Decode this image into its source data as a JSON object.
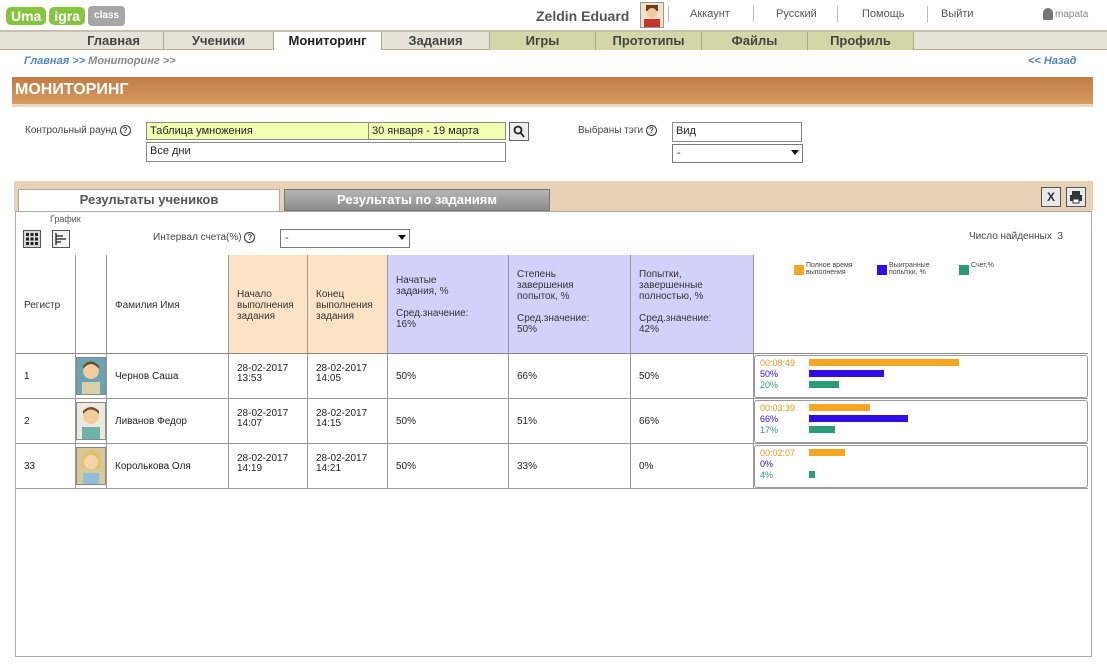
{
  "app": {
    "logo": [
      "Uma",
      "igra",
      "class"
    ],
    "user_name": "Zeldin Eduard",
    "top_links": [
      "Аккаунт",
      "Русский",
      "Помощь",
      "Выйти"
    ],
    "brand": "mapata"
  },
  "nav": {
    "items": [
      "Главная",
      "Ученики",
      "Мониторинг",
      "Задания",
      "Игры",
      "Прототипы",
      "Файлы",
      "Профиль"
    ],
    "active": "Мониторинг"
  },
  "breadcrumb": {
    "home": "Главная >>",
    "current": "Мониторинг >>",
    "back": "<< Назад"
  },
  "page": {
    "title": "МОНИТОРИНГ"
  },
  "filters": {
    "round_label": "Контрольный раунд",
    "round_value": "Таблица умножения",
    "date_range": "30 января - 19 марта",
    "days_value": "Все дни",
    "tags_label": "Выбраны тэги",
    "tags_value": "Вид",
    "tags_select": "-"
  },
  "tabs": {
    "students": "Результаты учеников",
    "tasks": "Результаты по заданиям",
    "active": "students"
  },
  "toolbar": {
    "graph_label": "График",
    "interval_label": "Интервал счета(%)",
    "interval_value": "-",
    "found_label": "Число найденных",
    "found_count": "3"
  },
  "table": {
    "headers": {
      "register": "Регистр",
      "name": "Фамилия Имя",
      "start": [
        "Начало",
        "выполнения",
        "задания"
      ],
      "end": [
        "Конец",
        "выполнения",
        "задания"
      ],
      "started": [
        "Начатые",
        "задания, %",
        "",
        "Сред.значение:",
        "16%"
      ],
      "completion": [
        "Степень",
        "завершения",
        "попыток, %",
        "",
        "Сред.значение:",
        "50%"
      ],
      "attempts": [
        "Попытки,",
        "завершенные",
        "полностью, %",
        "",
        "Сред.значение:",
        "42%"
      ]
    },
    "legend": [
      {
        "label": "Полное время выполнения",
        "color": "#f5a623"
      },
      {
        "label": "Выигранные попытки, %",
        "color": "#2e0de6"
      },
      {
        "label": "Счет,%",
        "color": "#2a9d74"
      }
    ],
    "rows": [
      {
        "register": "1",
        "name": "Чернов Саша",
        "start_date": "28-02-2017",
        "start_time": "13:53",
        "end_date": "28-02-2017",
        "end_time": "14:05",
        "started": "50%",
        "completion": "66%",
        "attempts": "50%",
        "time": "00:08:49",
        "won": "50%",
        "score": "20%",
        "time_frac": 1.0,
        "won_frac": 0.5,
        "score_frac": 0.2
      },
      {
        "register": "2",
        "name": "Ливанов Федор",
        "start_date": "28-02-2017",
        "start_time": "14:07",
        "end_date": "28-02-2017",
        "end_time": "14:15",
        "started": "50%",
        "completion": "51%",
        "attempts": "66%",
        "time": "00:03:39",
        "won": "66%",
        "score": "17%",
        "time_frac": 0.41,
        "won_frac": 0.66,
        "score_frac": 0.17
      },
      {
        "register": "33",
        "name": "Королькова Оля",
        "start_date": "28-02-2017",
        "start_time": "14:19",
        "end_date": "28-02-2017",
        "end_time": "14:21",
        "started": "50%",
        "completion": "33%",
        "attempts": "0%",
        "time": "00:02:07",
        "won": "0%",
        "score": "4%",
        "time_frac": 0.24,
        "won_frac": 0.0,
        "score_frac": 0.04
      }
    ]
  }
}
